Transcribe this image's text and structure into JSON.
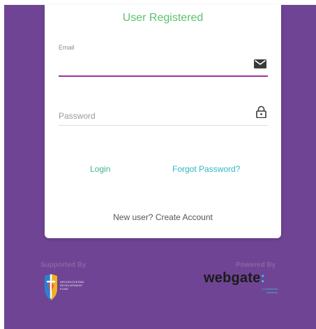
{
  "status_message": "User Registered",
  "form": {
    "email": {
      "label": "Email",
      "value": "",
      "icon": "envelope-icon"
    },
    "password": {
      "placeholder": "Password",
      "icon": "lock-icon"
    }
  },
  "links": {
    "login": "Login",
    "forgot_password": "Forgot Password?",
    "create_account": "New user? Create Account"
  },
  "footer": {
    "supported_by": "Supported By",
    "powered_by": "Powered By",
    "sponsor_logo": {
      "line1": "ARCHDIOCESAN",
      "line2": "DEVELOPMENT",
      "line3": "FUND"
    },
    "provider_logo": {
      "word": "webgate",
      "mark": ":",
      "tagline1": "e-commerce",
      "tagline2": "solutions"
    }
  },
  "colors": {
    "background": "#6f4494",
    "status_green": "#5dc26a",
    "accent_teal": "#2fb6c5",
    "email_underline": "#a0309c"
  }
}
